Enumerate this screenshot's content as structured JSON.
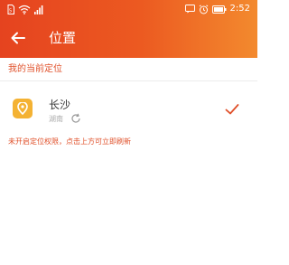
{
  "status_bar": {
    "time": "2:52",
    "left_icons": [
      "sim-icon",
      "wifi-icon",
      "signal-icon"
    ],
    "right_icons": [
      "message-icon",
      "alarm-icon",
      "battery-icon"
    ]
  },
  "header": {
    "title": "位置",
    "back_icon": "back-arrow-icon"
  },
  "section": {
    "label": "我的当前定位"
  },
  "location": {
    "city": "长沙",
    "status": "湖南",
    "icon": "location-pin-icon",
    "selected": true
  },
  "notice": {
    "text": "未开启定位权限，点击上方可立即刷新"
  },
  "colors": {
    "header_start": "#e5431f",
    "header_end": "#f38a2e",
    "accent": "#e0502a",
    "pin_bg": "#f4b233"
  }
}
